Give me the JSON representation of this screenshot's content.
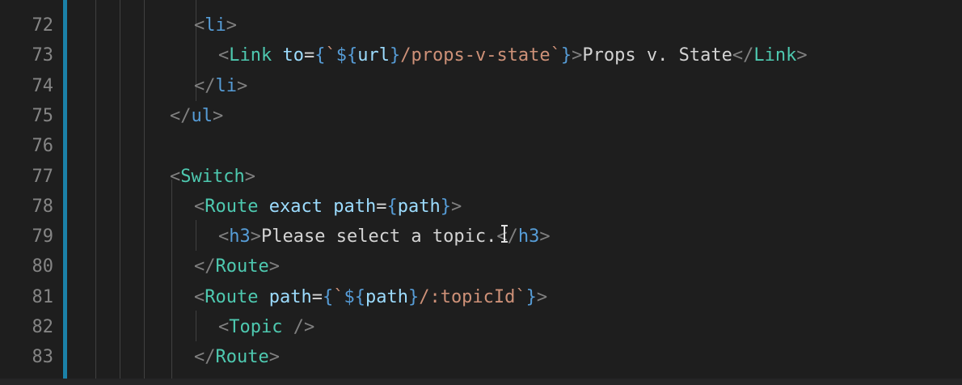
{
  "editor": {
    "lines": [
      {
        "number": "72",
        "tokens": [
          [
            "tag-br",
            "<"
          ],
          [
            "tag",
            "li"
          ],
          [
            "tag-br",
            ">"
          ]
        ]
      },
      {
        "number": "73",
        "tokens": [
          [
            "tag-br",
            "<"
          ],
          [
            "comp",
            "Link"
          ],
          [
            "txt",
            " "
          ],
          [
            "attr",
            "to"
          ],
          [
            "punct",
            "="
          ],
          [
            "brace",
            "{"
          ],
          [
            "str",
            "`"
          ],
          [
            "tpl",
            "${"
          ],
          [
            "var",
            "url"
          ],
          [
            "tpl",
            "}"
          ],
          [
            "str",
            "/props-v-state`"
          ],
          [
            "brace",
            "}"
          ],
          [
            "tag-br",
            ">"
          ],
          [
            "txt",
            "Props v. State"
          ],
          [
            "tag-br",
            "</"
          ],
          [
            "comp",
            "Link"
          ],
          [
            "tag-br",
            ">"
          ]
        ]
      },
      {
        "number": "74",
        "tokens": [
          [
            "tag-br",
            "</"
          ],
          [
            "tag",
            "li"
          ],
          [
            "tag-br",
            ">"
          ]
        ]
      },
      {
        "number": "75",
        "tokens": [
          [
            "tag-br",
            "</"
          ],
          [
            "tag",
            "ul"
          ],
          [
            "tag-br",
            ">"
          ]
        ]
      },
      {
        "number": "76",
        "tokens": []
      },
      {
        "number": "77",
        "tokens": [
          [
            "tag-br",
            "<"
          ],
          [
            "comp",
            "Switch"
          ],
          [
            "tag-br",
            ">"
          ]
        ]
      },
      {
        "number": "78",
        "tokens": [
          [
            "tag-br",
            "<"
          ],
          [
            "comp",
            "Route"
          ],
          [
            "txt",
            " "
          ],
          [
            "attr",
            "exact"
          ],
          [
            "txt",
            " "
          ],
          [
            "attr",
            "path"
          ],
          [
            "punct",
            "="
          ],
          [
            "brace",
            "{"
          ],
          [
            "var",
            "path"
          ],
          [
            "brace",
            "}"
          ],
          [
            "tag-br",
            ">"
          ]
        ]
      },
      {
        "number": "79",
        "tokens": [
          [
            "tag-br",
            "<"
          ],
          [
            "tag",
            "h3"
          ],
          [
            "tag-br",
            ">"
          ],
          [
            "txt",
            "Please select a topic."
          ],
          [
            "tag-br",
            "</"
          ],
          [
            "tag",
            "h3"
          ],
          [
            "tag-br",
            ">"
          ]
        ]
      },
      {
        "number": "80",
        "tokens": [
          [
            "tag-br",
            "</"
          ],
          [
            "comp",
            "Route"
          ],
          [
            "tag-br",
            ">"
          ]
        ]
      },
      {
        "number": "81",
        "tokens": [
          [
            "tag-br",
            "<"
          ],
          [
            "comp",
            "Route"
          ],
          [
            "txt",
            " "
          ],
          [
            "attr",
            "path"
          ],
          [
            "punct",
            "="
          ],
          [
            "brace",
            "{"
          ],
          [
            "str",
            "`"
          ],
          [
            "tpl",
            "${"
          ],
          [
            "var",
            "path"
          ],
          [
            "tpl",
            "}"
          ],
          [
            "str",
            "/:topicId`"
          ],
          [
            "brace",
            "}"
          ],
          [
            "tag-br",
            ">"
          ]
        ]
      },
      {
        "number": "82",
        "tokens": [
          [
            "tag-br",
            "<"
          ],
          [
            "comp",
            "Topic"
          ],
          [
            "txt",
            " "
          ],
          [
            "tag-br",
            "/>"
          ]
        ]
      },
      {
        "number": "83",
        "tokens": [
          [
            "tag-br",
            "</"
          ],
          [
            "comp",
            "Route"
          ],
          [
            "tag-br",
            ">"
          ]
        ]
      }
    ]
  }
}
